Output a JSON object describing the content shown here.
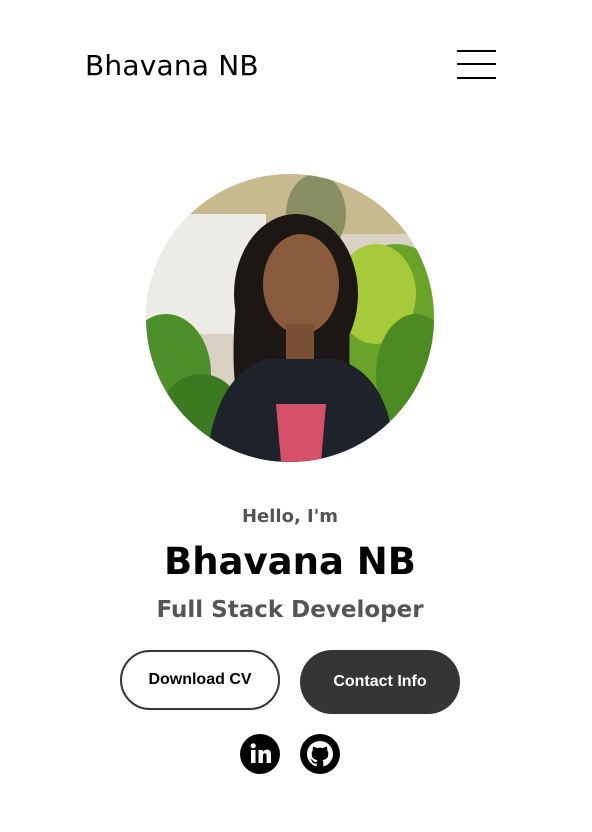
{
  "header": {
    "logo_text": "Bhavana NB",
    "menu_icon": "hamburger-menu-icon"
  },
  "profile": {
    "photo_alt": "Profile picture",
    "greeting": "Hello, I'm",
    "name": "Bhavana NB",
    "role": "Full Stack Developer"
  },
  "buttons": {
    "download_cv": "Download CV",
    "contact_info": "Contact Info"
  },
  "social": {
    "linkedin_icon": "linkedin-icon",
    "github_icon": "github-icon"
  },
  "colors": {
    "primary_dark": "#353535",
    "text_gray": "#555555",
    "background": "#ffffff"
  }
}
